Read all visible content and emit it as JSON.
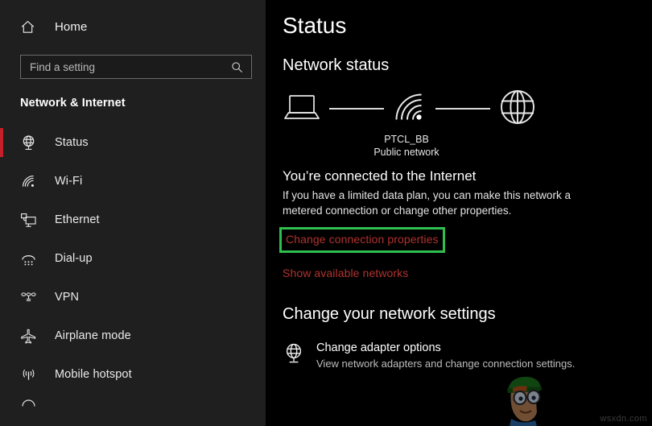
{
  "window": {
    "sidebar_bg": "#1f1f1f",
    "main_bg": "#000000",
    "accent_selected": "#c4202a",
    "link_color": "#b1322f",
    "highlight_color": "#2fbf4f"
  },
  "sidebar": {
    "home": {
      "label": "Home",
      "icon": "home-icon"
    },
    "search": {
      "value": "",
      "placeholder": "Find a setting",
      "icon": "search-icon"
    },
    "category": "Network & Internet",
    "items": [
      {
        "label": "Status",
        "icon": "globe-stand-icon",
        "selected": true
      },
      {
        "label": "Wi-Fi",
        "icon": "wifi-icon",
        "selected": false
      },
      {
        "label": "Ethernet",
        "icon": "ethernet-icon",
        "selected": false
      },
      {
        "label": "Dial-up",
        "icon": "dialup-icon",
        "selected": false
      },
      {
        "label": "VPN",
        "icon": "vpn-icon",
        "selected": false
      },
      {
        "label": "Airplane mode",
        "icon": "airplane-icon",
        "selected": false
      },
      {
        "label": "Mobile hotspot",
        "icon": "mobile-hotspot-icon",
        "selected": false
      },
      {
        "label": "",
        "icon": "proxy-icon",
        "selected": false
      }
    ]
  },
  "main": {
    "page_title": "Status",
    "network_status_heading": "Network status",
    "diagram": {
      "device_icon": "laptop-icon",
      "connection_icon": "wifi-icon",
      "internet_icon": "globe-icon",
      "network_name": "PTCL_BB",
      "network_type": "Public network"
    },
    "connection_heading": "You’re connected to the Internet",
    "connection_description": "If you have a limited data plan, you can make this network a metered connection or change other properties.",
    "change_connection_properties_link": "Change connection properties",
    "show_available_networks_link": "Show available networks",
    "settings_heading": "Change your network settings",
    "options": [
      {
        "icon": "globe-stand-icon",
        "title": "Change adapter options",
        "subtitle": "View network adapters and change connection settings."
      }
    ]
  },
  "watermark": {
    "text": "wsxdn.com",
    "character_icon": "cartoon-character-watermark"
  }
}
